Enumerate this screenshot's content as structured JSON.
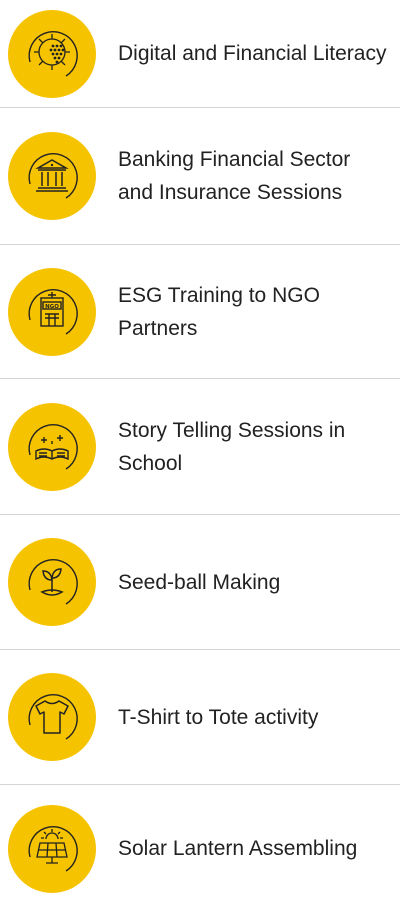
{
  "items": [
    {
      "label": "Digital and Financial Literacy",
      "icon": "digital-brain-gear-icon"
    },
    {
      "label": "Banking Financial Sector and Insurance Sessions",
      "icon": "bank-building-icon"
    },
    {
      "label": "ESG Training to NGO Partners",
      "icon": "ngo-building-icon"
    },
    {
      "label": "Story Telling Sessions in School",
      "icon": "open-book-sparkle-icon"
    },
    {
      "label": "Seed-ball Making",
      "icon": "sprout-icon"
    },
    {
      "label": "T-Shirt to Tote activity",
      "icon": "tshirt-icon"
    },
    {
      "label": "Solar Lantern Assembling",
      "icon": "solar-panel-icon"
    }
  ],
  "colors": {
    "accent": "#f6c300",
    "divider": "#d4d4d4",
    "text": "#222222"
  }
}
